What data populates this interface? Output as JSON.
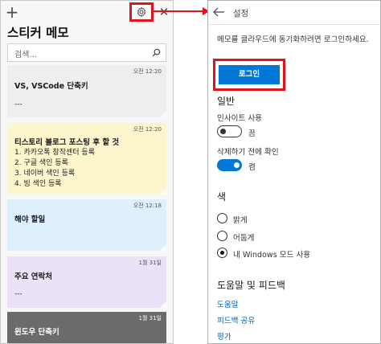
{
  "list_window": {
    "add_icon": "plus-icon",
    "settings_icon": "gear-icon",
    "close_icon": "close-icon",
    "title": "스티커 메모",
    "search": {
      "placeholder": "검색...",
      "icon": "search-icon"
    },
    "notes": [
      {
        "time": "오전 12:20",
        "title": "VS, VSCode 단축키",
        "lines": [
          "---"
        ],
        "color": "#eeeeee"
      },
      {
        "time": "오전 12:20",
        "title": "티스토리 블로그 포스팅 후 할 것",
        "lines": [
          "1. 카카오톡 창작센터 등록",
          "2. 구글 색인 등록",
          "3. 네이버 색인 등록",
          "4. 빙 색인 등록"
        ],
        "color": "#fdf5cc"
      },
      {
        "time": "오전 12:18",
        "title": "해야 할일",
        "lines": [],
        "color": "#dff0fd"
      },
      {
        "time": "1월 31일",
        "title": "주요 연락처",
        "lines": [
          "---"
        ],
        "color": "#ebe2f7"
      },
      {
        "time": "1월 31일",
        "title": "윈도우 단축키",
        "lines": [],
        "color": "#6b6b6b"
      }
    ]
  },
  "settings_window": {
    "back_icon": "back-arrow-icon",
    "title": "설정",
    "login_description": "메모를 클라우드에 동기화하려면 로그인하세요.",
    "login_button": "로그인",
    "general": {
      "heading": "일반",
      "insights_label": "인사이트 사용",
      "insights_state": "끔",
      "insights_on": false,
      "confirm_delete_label": "삭제하기 전에 확인",
      "confirm_delete_state": "켬",
      "confirm_delete_on": true
    },
    "color": {
      "heading": "색",
      "options": [
        "밝게",
        "어둡게",
        "내 Windows 모드 사용"
      ],
      "selected": "내 Windows 모드 사용"
    },
    "help": {
      "heading": "도움말 및 피드백",
      "links": [
        "도움말",
        "피드백 공유",
        "평가"
      ]
    }
  },
  "colors": {
    "highlight_red": "#e0141e",
    "accent_blue": "#0078d7",
    "link_blue": "#0063b1"
  }
}
